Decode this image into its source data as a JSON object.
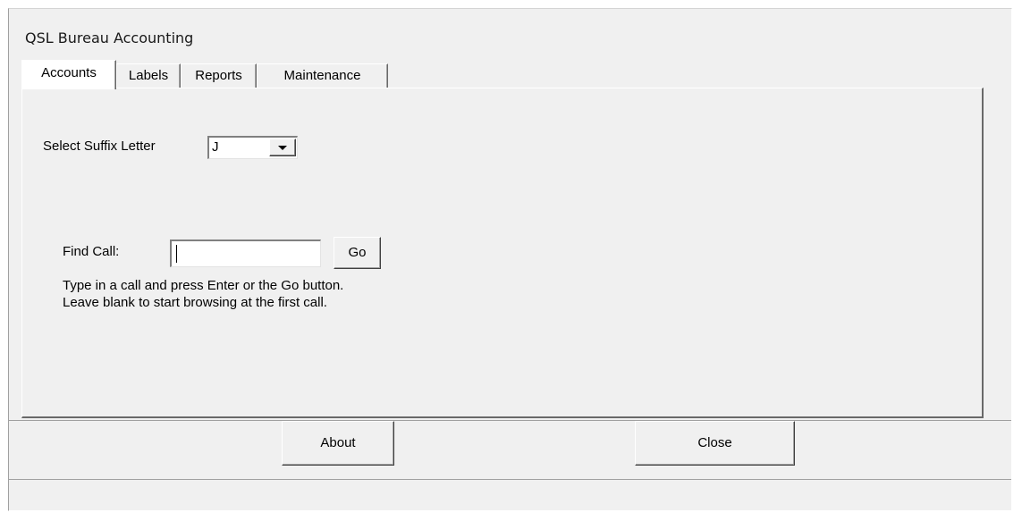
{
  "form": {
    "title": "QSL Bureau Accounting"
  },
  "tabs": [
    {
      "label": "Accounts",
      "active": true
    },
    {
      "label": "Labels",
      "active": false
    },
    {
      "label": "Reports",
      "active": false
    },
    {
      "label": "Maintenance",
      "active": false
    }
  ],
  "accounts": {
    "suffix_label": "Select Suffix Letter",
    "suffix_value": "J",
    "find_label": "Find Call:",
    "find_value": "",
    "go_label": "Go",
    "help_line1": "Type in a call and press Enter or the Go button.",
    "help_line2": "Leave blank to start browsing at the first call."
  },
  "footer": {
    "about_label": "About",
    "close_label": "Close"
  },
  "icons": {
    "dropdown": "chevron-down-icon"
  },
  "colors": {
    "background": "#f0f0f0",
    "window_bg": "#ffffff",
    "border_dark": "#696969"
  }
}
